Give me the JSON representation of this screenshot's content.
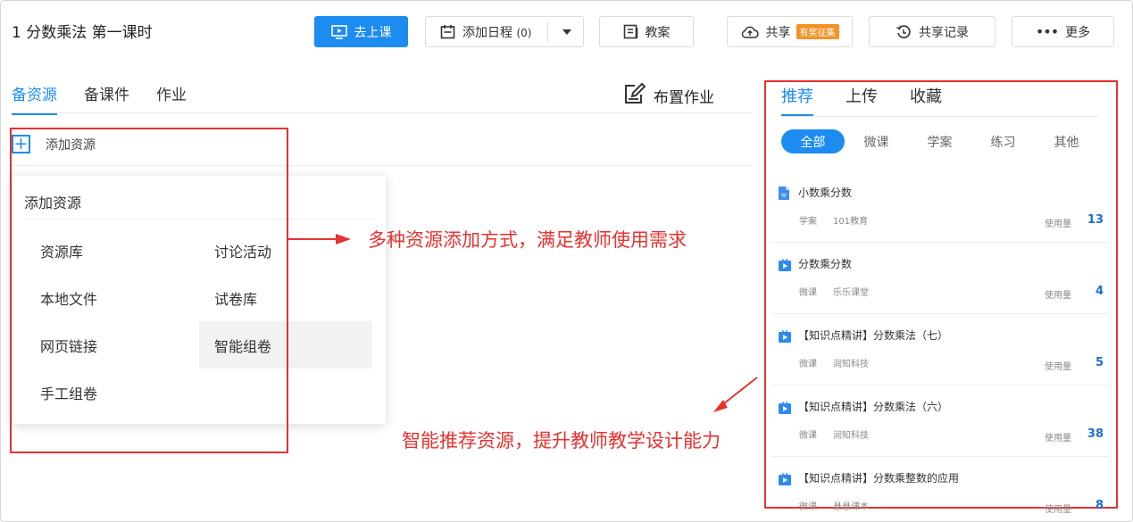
{
  "header": {
    "title": "1 分数乘法 第一课时",
    "buttons": {
      "start_class": "去上课",
      "add_schedule": "添加日程",
      "schedule_count": "(0)",
      "lesson_plan": "教案",
      "share": "共享",
      "share_badge": "有奖征集",
      "share_record": "共享记录",
      "more": "更多"
    }
  },
  "left": {
    "tabs": [
      "备资源",
      "备课件",
      "作业"
    ],
    "assign_homework": "布置作业",
    "add_resource": "添加资源",
    "popup": {
      "title": "添加资源",
      "items": [
        "资源库",
        "讨论活动",
        "本地文件",
        "试卷库",
        "网页链接",
        "智能组卷",
        "手工组卷"
      ]
    }
  },
  "annotations": {
    "left_note": "多种资源添加方式，满足教师使用需求",
    "right_note": "智能推荐资源，提升教师教学设计能力"
  },
  "right": {
    "tabs": [
      "推荐",
      "上传",
      "收藏"
    ],
    "filters": [
      "全部",
      "微课",
      "学案",
      "练习",
      "其他"
    ],
    "usage_label": "使用量",
    "resources": [
      {
        "title": "小数乘分数",
        "type": "学案",
        "source": "101教育",
        "count": "13",
        "icon": "word-doc-icon"
      },
      {
        "title": "分数乘分数",
        "type": "微课",
        "source": "乐乐课堂",
        "count": "4",
        "icon": "video-icon"
      },
      {
        "title": "【知识点精讲】分数乘法（七）",
        "type": "微课",
        "source": "润知科技",
        "count": "5",
        "icon": "video-icon"
      },
      {
        "title": "【知识点精讲】分数乘法（六）",
        "type": "微课",
        "source": "润知科技",
        "count": "38",
        "icon": "video-icon"
      },
      {
        "title": "【知识点精讲】分数乘整数的应用",
        "type": "微课",
        "source": "悬悬课本",
        "count": "8",
        "icon": "video-icon"
      }
    ]
  },
  "colors": {
    "primary": "#1d8cf0",
    "annotation_red": "#e8312f",
    "badge_orange": "#f29427",
    "count_blue": "#1d6fd6"
  }
}
